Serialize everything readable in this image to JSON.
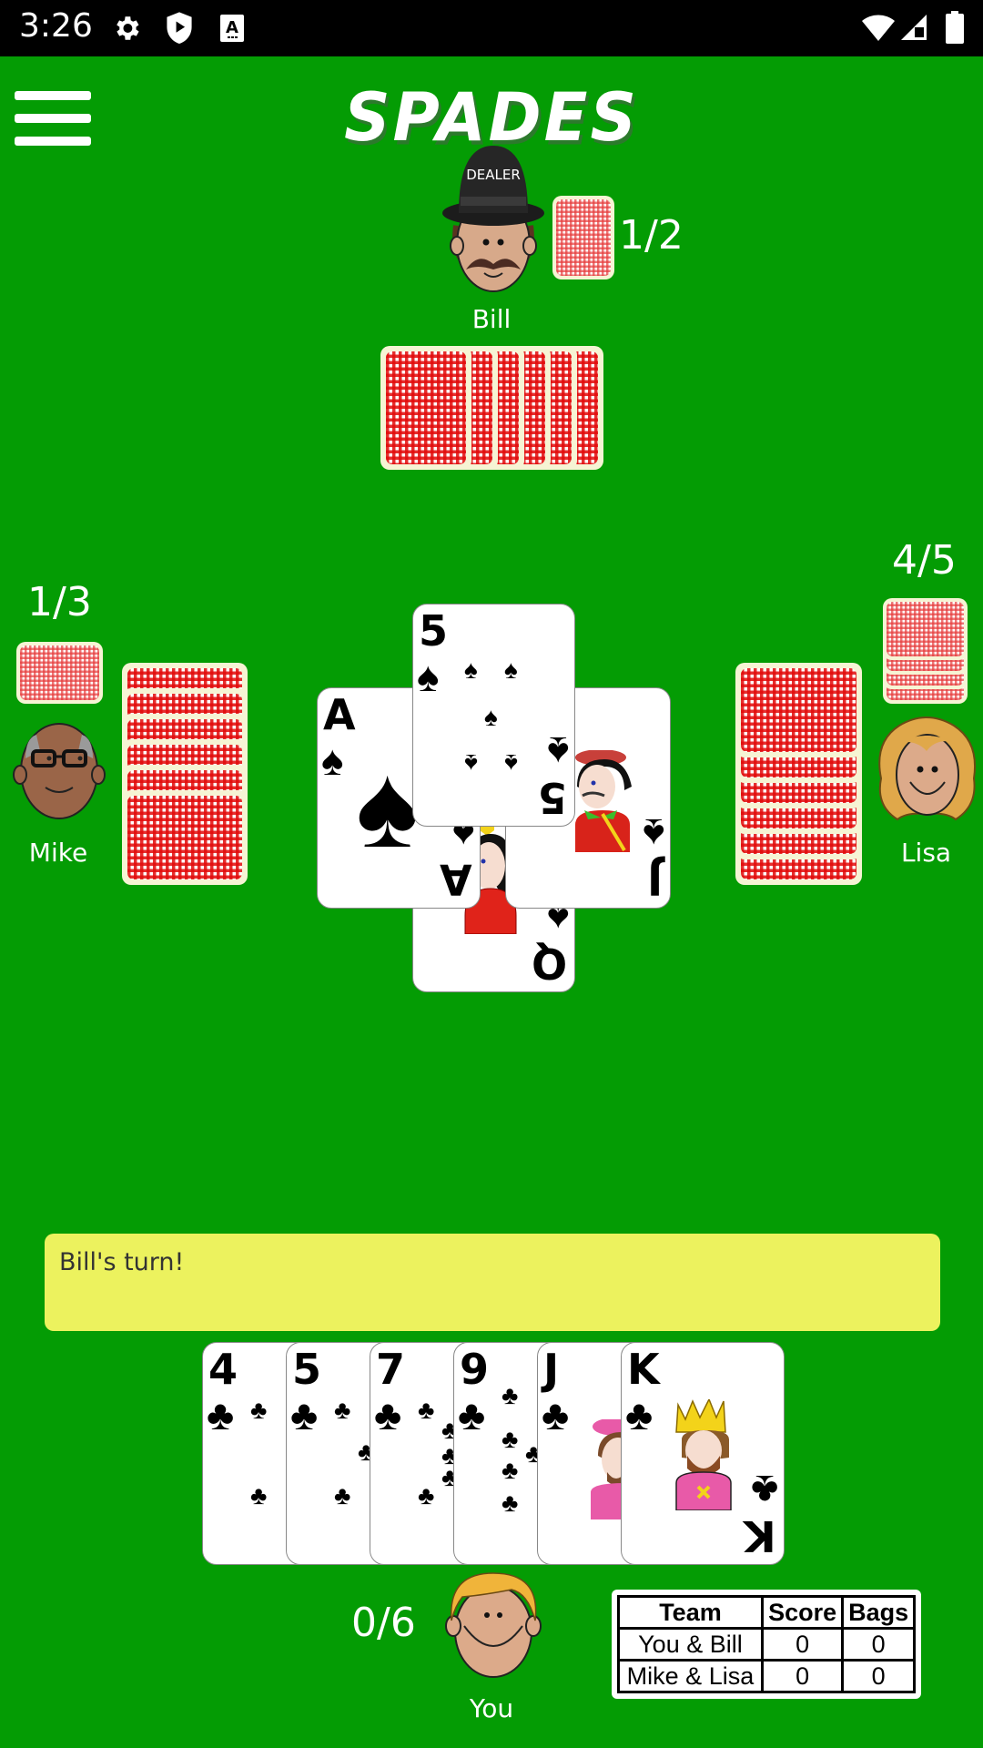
{
  "status_bar": {
    "time": "3:26",
    "left_icons": [
      "gear-icon",
      "play-shield-icon",
      "accessibility-a-icon"
    ],
    "right_icons": [
      "wifi-icon",
      "cellular-signal-icon",
      "battery-icon"
    ]
  },
  "header": {
    "menu_icon": "hamburger-menu-icon",
    "title": "SPADES"
  },
  "colors": {
    "table_green": "#049c04",
    "message_yellow": "#ecf25e",
    "card_back_red": "#e20a0a",
    "card_back_border": "#f6f4d4"
  },
  "players": {
    "north": {
      "name": "Bill",
      "tricks": "1/2",
      "is_dealer": true,
      "dealer_label": "DEALER",
      "cards_in_hand": 6,
      "tricks_won_cards": 1
    },
    "west": {
      "name": "Mike",
      "tricks": "1/3",
      "cards_in_hand": 6,
      "tricks_won_cards": 1
    },
    "east": {
      "name": "Lisa",
      "tricks": "4/5",
      "cards_in_hand": 6,
      "tricks_won_cards": 4
    },
    "south": {
      "name": "You",
      "tricks": "0/6"
    }
  },
  "trick": {
    "west": {
      "rank": "A",
      "suit": "♠"
    },
    "north": {
      "rank": "5",
      "suit": "♠"
    },
    "east": {
      "rank": "J",
      "suit": "♠"
    },
    "south": {
      "rank": "Q",
      "suit": "♠"
    }
  },
  "message": "Bill's  turn!",
  "hand": [
    {
      "rank": "4",
      "suit": "♣"
    },
    {
      "rank": "5",
      "suit": "♣"
    },
    {
      "rank": "7",
      "suit": "♣"
    },
    {
      "rank": "9",
      "suit": "♣"
    },
    {
      "rank": "J",
      "suit": "♣"
    },
    {
      "rank": "K",
      "suit": "♣"
    }
  ],
  "scoreboard": {
    "headers": [
      "Team",
      "Score",
      "Bags"
    ],
    "rows": [
      [
        "You & Bill",
        "0",
        "0"
      ],
      [
        "Mike & Lisa",
        "0",
        "0"
      ]
    ]
  }
}
